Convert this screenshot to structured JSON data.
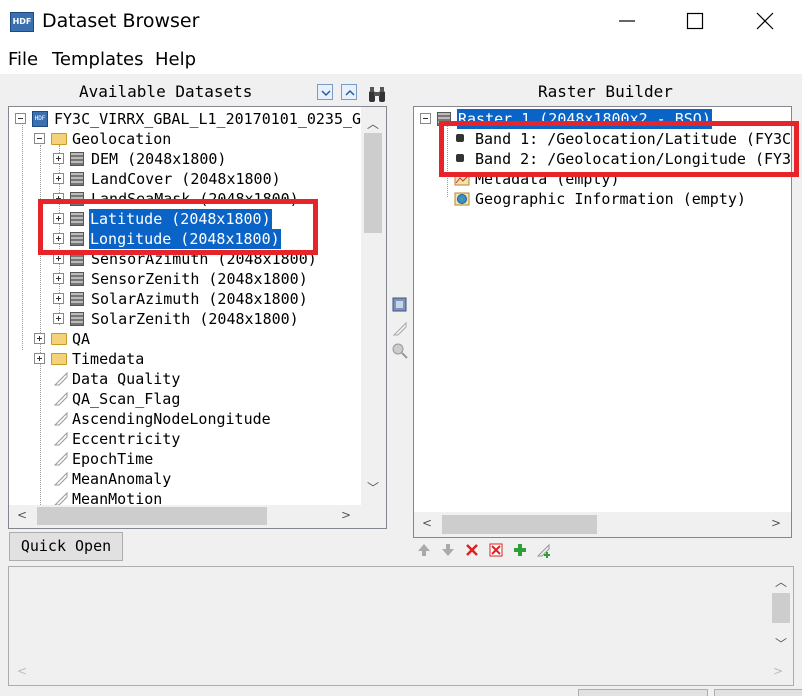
{
  "window": {
    "title": "Dataset Browser",
    "icon_text": "HDF"
  },
  "menubar": {
    "items": [
      "File",
      "Templates",
      "Help"
    ]
  },
  "available_datasets": {
    "title": "Available Datasets",
    "root": "FY3C_VIRRX_GBAL_L1_20170101_0235_G",
    "geolocation_folder": "Geolocation",
    "geolocation_items": [
      "DEM (2048x1800)",
      "LandCover (2048x1800)",
      "LandSeaMask (2048x1800)",
      "Latitude (2048x1800)",
      "Longitude (2048x1800)",
      "SensorAzimuth (2048x1800)",
      "SensorZenith (2048x1800)",
      "SolarAzimuth (2048x1800)",
      "SolarZenith (2048x1800)"
    ],
    "folders": [
      "QA",
      "Timedata"
    ],
    "attributes": [
      "Data Quality",
      "QA_Scan_Flag",
      "AscendingNodeLongitude",
      "Eccentricity",
      "EpochTime",
      "MeanAnomaly",
      "MeanMotion"
    ]
  },
  "raster_builder": {
    "title": "Raster Builder",
    "raster": "Raster 1 (2048x1800x2 - BSQ)",
    "bands": [
      "Band 1: /Geolocation/Latitude (FY3C",
      "Band 2: /Geolocation/Longitude (FY3"
    ],
    "metadata": "Metadata (empty)",
    "geographic_info": "Geographic Information (empty)"
  },
  "buttons": {
    "quick_open": "Quick Open"
  },
  "colors": {
    "selection": "#0a64c8",
    "annotation_red": "#e8242b"
  }
}
